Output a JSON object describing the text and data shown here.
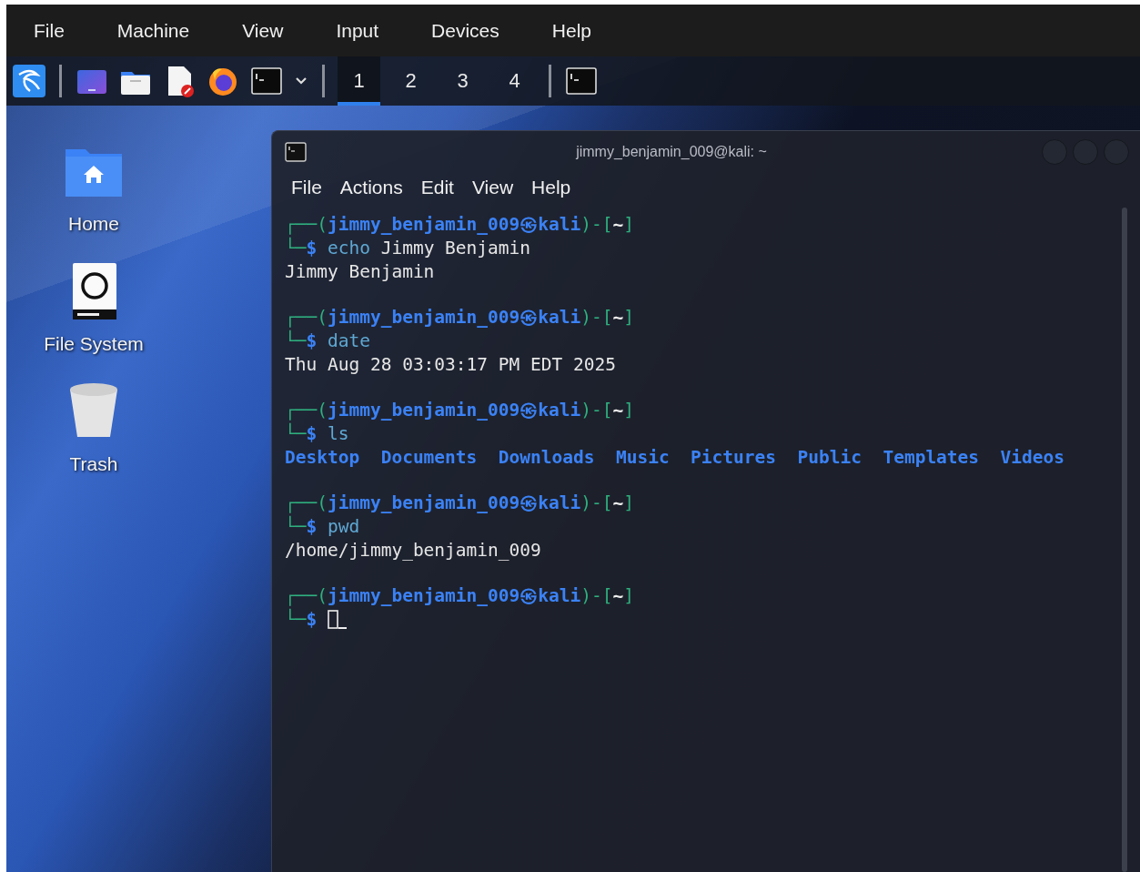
{
  "host_menu": [
    "File",
    "Machine",
    "View",
    "Input",
    "Devices",
    "Help"
  ],
  "panel": {
    "launchers": [
      {
        "kind": "kali"
      },
      {
        "kind": "desktop"
      },
      {
        "kind": "files"
      },
      {
        "kind": "editor"
      },
      {
        "kind": "browser"
      },
      {
        "kind": "terminal"
      },
      {
        "kind": "chevron"
      }
    ],
    "workspaces": [
      {
        "label": "1",
        "selected": true
      },
      {
        "label": "2",
        "selected": false
      },
      {
        "label": "3",
        "selected": false
      },
      {
        "label": "4",
        "selected": false
      }
    ],
    "tasks": [
      {
        "kind": "terminal"
      }
    ]
  },
  "desktop_icons": [
    {
      "label": "Home",
      "kind": "home"
    },
    {
      "label": "File System",
      "kind": "drive"
    },
    {
      "label": "Trash",
      "kind": "trash"
    }
  ],
  "terminal": {
    "title": "jimmy_benjamin_009@kali: ~",
    "menu": [
      "File",
      "Actions",
      "Edit",
      "View",
      "Help"
    ],
    "blocks": [
      {
        "prompt": [
          {
            "text": "┌──(",
            "kind": "frame"
          },
          {
            "text": "jimmy_benjamin_009㉿kali",
            "kind": "user"
          },
          {
            "text": ")-[",
            "kind": "frame"
          },
          {
            "text": "~",
            "kind": "dir"
          },
          {
            "text": "]",
            "kind": "frame"
          }
        ],
        "command": [
          {
            "text": "└─",
            "kind": "frame"
          },
          {
            "text": "$",
            "kind": "user"
          },
          {
            "text": " echo",
            "kind": "cmd"
          },
          {
            "text": " Jimmy Benjamin",
            "kind": "arg"
          }
        ],
        "output": {
          "kind": "text",
          "lines": [
            "Jimmy Benjamin"
          ]
        },
        "cursor": false
      },
      {
        "prompt": [
          {
            "text": "┌──(",
            "kind": "frame"
          },
          {
            "text": "jimmy_benjamin_009㉿kali",
            "kind": "user"
          },
          {
            "text": ")-[",
            "kind": "frame"
          },
          {
            "text": "~",
            "kind": "dir"
          },
          {
            "text": "]",
            "kind": "frame"
          }
        ],
        "command": [
          {
            "text": "└─",
            "kind": "frame"
          },
          {
            "text": "$",
            "kind": "user"
          },
          {
            "text": " date",
            "kind": "cmd"
          }
        ],
        "output": {
          "kind": "text",
          "lines": [
            "Thu Aug 28 03:03:17 PM EDT 2025"
          ]
        },
        "cursor": false
      },
      {
        "prompt": [
          {
            "text": "┌──(",
            "kind": "frame"
          },
          {
            "text": "jimmy_benjamin_009㉿kali",
            "kind": "user"
          },
          {
            "text": ")-[",
            "kind": "frame"
          },
          {
            "text": "~",
            "kind": "dir"
          },
          {
            "text": "]",
            "kind": "frame"
          }
        ],
        "command": [
          {
            "text": "└─",
            "kind": "frame"
          },
          {
            "text": "$",
            "kind": "user"
          },
          {
            "text": " ls",
            "kind": "cmd"
          }
        ],
        "output": {
          "kind": "dirs",
          "lines": [
            "Desktop",
            "Documents",
            "Downloads",
            "Music",
            "Pictures",
            "Public",
            "Templates",
            "Videos"
          ]
        },
        "cursor": false
      },
      {
        "prompt": [
          {
            "text": "┌──(",
            "kind": "frame"
          },
          {
            "text": "jimmy_benjamin_009㉿kali",
            "kind": "user"
          },
          {
            "text": ")-[",
            "kind": "frame"
          },
          {
            "text": "~",
            "kind": "dir"
          },
          {
            "text": "]",
            "kind": "frame"
          }
        ],
        "command": [
          {
            "text": "└─",
            "kind": "frame"
          },
          {
            "text": "$",
            "kind": "user"
          },
          {
            "text": " pwd",
            "kind": "cmd"
          }
        ],
        "output": {
          "kind": "text",
          "lines": [
            "/home/jimmy_benjamin_009"
          ]
        },
        "cursor": false
      },
      {
        "prompt": [
          {
            "text": "┌──(",
            "kind": "frame"
          },
          {
            "text": "jimmy_benjamin_009㉿kali",
            "kind": "user"
          },
          {
            "text": ")-[",
            "kind": "frame"
          },
          {
            "text": "~",
            "kind": "dir"
          },
          {
            "text": "]",
            "kind": "frame"
          }
        ],
        "command": [
          {
            "text": "└─",
            "kind": "frame"
          },
          {
            "text": "$",
            "kind": "user"
          }
        ],
        "cursor": true
      }
    ]
  }
}
